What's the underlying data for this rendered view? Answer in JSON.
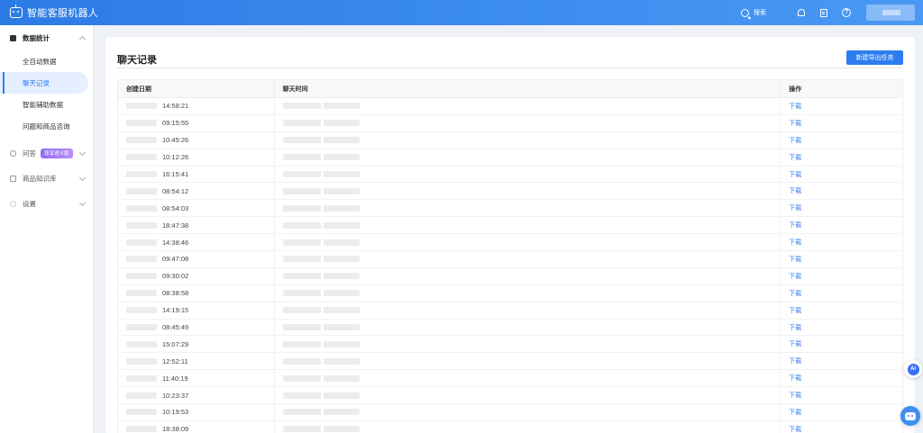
{
  "app": {
    "title": "智能客服机器人"
  },
  "header": {
    "search_label": "搜索",
    "icons": [
      "bell-icon",
      "document-icon",
      "help-icon"
    ],
    "help_glyph": "?"
  },
  "sidebar": {
    "groups": [
      {
        "label": "数据统计",
        "icon": "chart-icon",
        "expanded": true,
        "items": [
          {
            "label": "全自动数据",
            "active": false
          },
          {
            "label": "聊天记录",
            "active": true
          },
          {
            "label": "智能辅助数据",
            "active": false
          },
          {
            "label": "问题和商品咨询",
            "active": false
          }
        ]
      },
      {
        "label": "问答",
        "icon": "chat-icon",
        "badge": "尊享语义版"
      },
      {
        "label": "商品知识库",
        "icon": "box-icon"
      },
      {
        "label": "设置",
        "icon": "gear-icon"
      }
    ]
  },
  "main": {
    "title": "聊天记录",
    "new_export_button": "新建导出任务",
    "table": {
      "headers": [
        "创建日期",
        "聊天时间",
        "操作"
      ],
      "action_label": "下载",
      "times": [
        "14:58:21",
        "09:15:55",
        "10:45:26",
        "10:12:26",
        "16:15:41",
        "08:54:12",
        "08:54:03",
        "18:47:38",
        "14:38:46",
        "09:47:08",
        "09:30:02",
        "08:38:58",
        "14:19:15",
        "08:45:49",
        "15:07:29",
        "12:52:11",
        "11:40:19",
        "10:23:37",
        "10:19:53",
        "18:38:09"
      ]
    }
  },
  "floating": {
    "ai_label": "Ai"
  },
  "colors": {
    "primary": "#2d7cf0",
    "header": "#3d8ef0",
    "badge": "#a07cf6"
  }
}
